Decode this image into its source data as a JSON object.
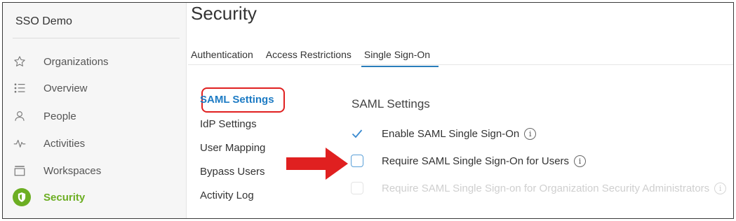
{
  "sidebar": {
    "app_title": "SSO Demo",
    "items": [
      {
        "label": "Organizations",
        "icon": "star-icon"
      },
      {
        "label": "Overview",
        "icon": "list-icon"
      },
      {
        "label": "People",
        "icon": "person-icon"
      },
      {
        "label": "Activities",
        "icon": "pulse-icon"
      },
      {
        "label": "Workspaces",
        "icon": "workspace-icon"
      },
      {
        "label": "Security",
        "icon": "shield-icon",
        "active": true
      }
    ]
  },
  "main": {
    "page_title": "Security",
    "tabs": [
      {
        "label": "Authentication"
      },
      {
        "label": "Access Restrictions"
      },
      {
        "label": "Single Sign-On",
        "active": true
      }
    ],
    "subnav": [
      {
        "label": "SAML Settings",
        "active": true
      },
      {
        "label": "IdP Settings"
      },
      {
        "label": "User Mapping"
      },
      {
        "label": "Bypass Users"
      },
      {
        "label": "Activity Log"
      }
    ],
    "section_title": "SAML Settings",
    "options": [
      {
        "label": "Enable SAML Single Sign-On",
        "checked": true,
        "disabled": false
      },
      {
        "label": "Require SAML Single Sign-On for Users",
        "checked": false,
        "disabled": false
      },
      {
        "label": "Require SAML Single Sign-on for Organization Security Administrators",
        "checked": false,
        "disabled": true
      }
    ],
    "info_glyph": "i"
  },
  "colors": {
    "accent_green": "#6cae22",
    "link_blue": "#1d7bc4",
    "tab_underline": "#2a7ebb",
    "annotation_red": "#e02020"
  }
}
